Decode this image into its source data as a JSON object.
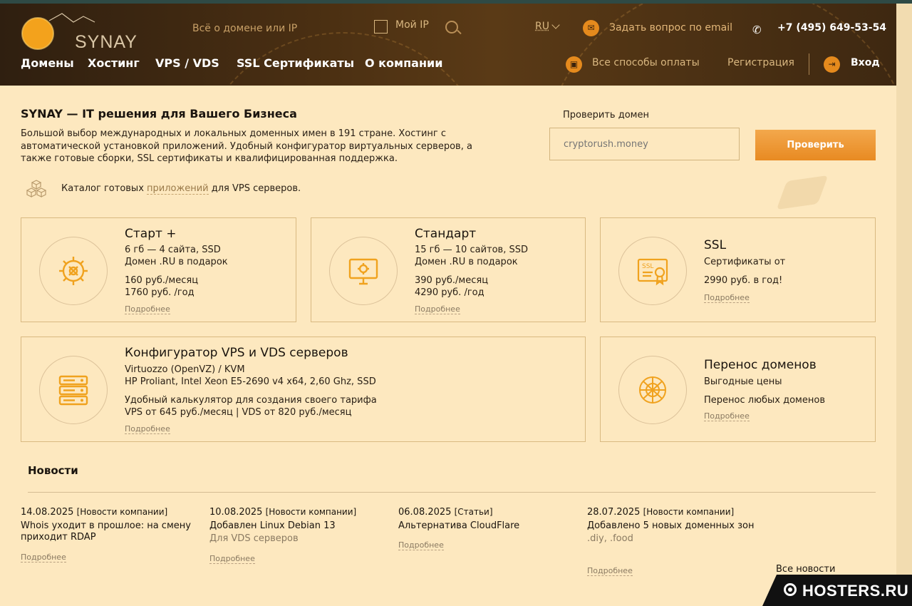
{
  "colors": {
    "accent": "#e88a22",
    "header_bg": "#3e2811",
    "page_bg": "#fde8bf",
    "border": "#d9b981"
  },
  "header": {
    "logo_text": "SYNAY",
    "search_placeholder": "Всё о домене или IP",
    "my_ip_label": "Мой IP",
    "lang": "RU",
    "email_label": "Задать вопрос по email",
    "phone": "+7 (495) 649-53-54",
    "nav": [
      "Домены",
      "Хостинг",
      "VPS / VDS",
      "SSL Сертификаты",
      "О компании"
    ],
    "payment_label": "Все способы оплаты",
    "register_label": "Регистрация",
    "login_label": "Вход"
  },
  "intro": {
    "title": "SYNAY — IT решения для Вашего Бизнеса",
    "text": "Большой выбор международных и локальных доменных имен в 191 стране. Хостинг с автоматической установкой приложений. Удобный конфигуратор виртуальных серверов, а также готовые сборки, SSL сертификаты и квалифицированная поддержка.",
    "catalog_before": "Каталог готовых ",
    "catalog_link": "приложений",
    "catalog_after": " для VPS серверов."
  },
  "domain_check": {
    "label": "Проверить домен",
    "placeholder": "cryptorush.money",
    "button": "Проверить"
  },
  "cards": {
    "start": {
      "title": "Старт +",
      "line1": "6 гб — 4 сайта, SSD",
      "line2": "Домен .RU в подарок",
      "price1": "160 руб./месяц",
      "price2": "1760 руб. /год",
      "more": "Подробнее"
    },
    "standard": {
      "title": "Стандарт",
      "line1": "15 гб — 10 сайтов, SSD",
      "line2": "Домен .RU в подарок",
      "price1": "390 руб./месяц",
      "price2": "4290 руб. /год",
      "more": "Подробнее"
    },
    "ssl": {
      "title": "SSL",
      "line1": "Сертификаты от",
      "price1": "2990 руб. в год!",
      "more": "Подробнее"
    },
    "vps": {
      "title": "Конфигуратор VPS и VDS серверов",
      "line1": "Virtuozzo (OpenVZ) / KVM",
      "line2": "HP Proliant, Intel Xeon E5-2690 v4 x64, 2,60 Ghz, SSD",
      "line3": "Удобный калькулятор для создания своего тарифа",
      "line4": "VPS от 645 руб./месяц | VDS от 820 руб./месяц",
      "more": "Подробнее"
    },
    "transfer": {
      "title": "Перенос доменов",
      "line1": "Выгодные цены",
      "line2": "Перенос любых доменов",
      "more": "Подробнее"
    }
  },
  "news": {
    "heading": "Новости",
    "items": [
      {
        "date": "14.08.2025",
        "category": "[Новости компании]",
        "title": "Whois уходит в прошлое: на смену приходит RDAP",
        "sub": "",
        "more": "Подробнее"
      },
      {
        "date": "10.08.2025",
        "category": "[Новости компании]",
        "title": "Добавлен Linux Debian 13",
        "sub": "Для VDS серверов",
        "more": "Подробнее"
      },
      {
        "date": "06.08.2025",
        "category": "[Статьи]",
        "title": "Альтернатива CloudFlare",
        "sub": "",
        "more": "Подробнее"
      },
      {
        "date": "28.07.2025",
        "category": "[Новости компании]",
        "title": "Добавлено 5 новых доменных зон",
        "sub": ".diy, .food",
        "more": "Подробнее"
      }
    ],
    "all_label": "Все новости"
  },
  "watermark": "HOSTERS.RU"
}
